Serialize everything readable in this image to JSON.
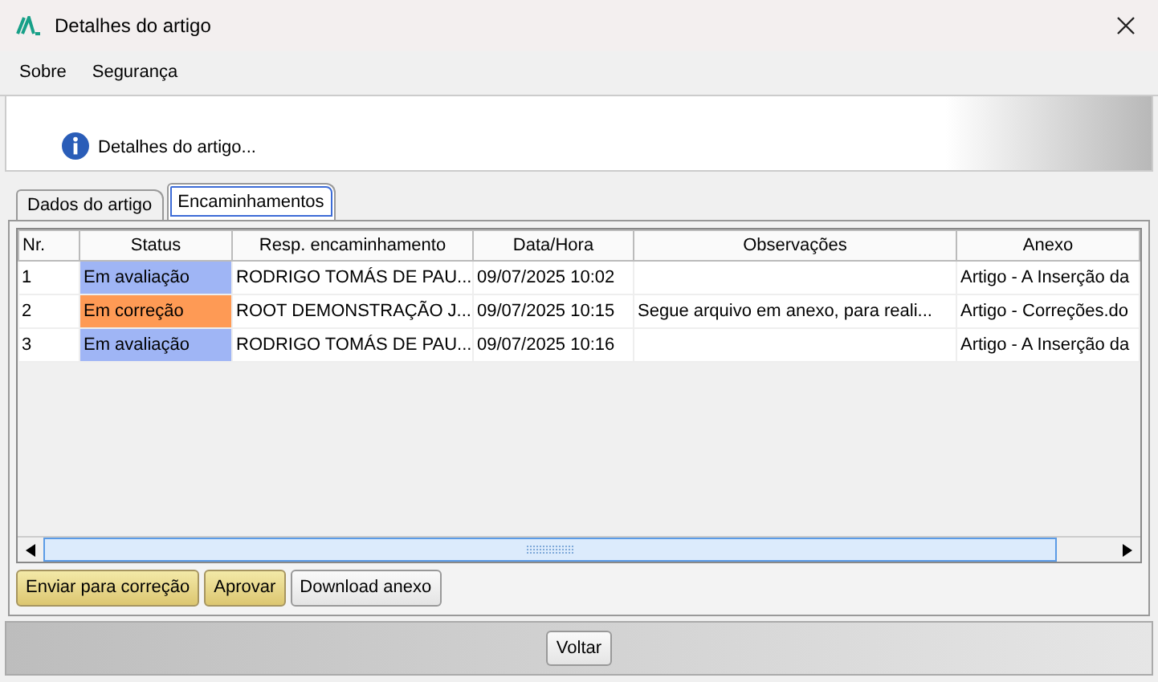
{
  "window": {
    "title": "Detalhes do artigo"
  },
  "menu": [
    "Sobre",
    "Segurança"
  ],
  "header": {
    "text": "Detalhes do artigo..."
  },
  "tabs": [
    {
      "label": "Dados do artigo",
      "selected": false
    },
    {
      "label": "Encaminhamentos",
      "selected": true
    }
  ],
  "table": {
    "columns": [
      "Nr.",
      "Status",
      "Resp. encaminhamento",
      "Data/Hora",
      "Observações",
      "Anexo"
    ],
    "rows": [
      {
        "nr": "1",
        "status": "Em avaliação",
        "color": "#9fb5f5",
        "resp": "RODRIGO TOMÁS DE PAU...",
        "datetime": "09/07/2025 10:02",
        "obs": "",
        "anexo": "Artigo - A Inserção da"
      },
      {
        "nr": "2",
        "status": "Em correção",
        "color": "#fe9a55",
        "resp": "ROOT DEMONSTRAÇÃO J...",
        "datetime": "09/07/2025 10:15",
        "obs": "Segue arquivo em anexo, para reali...",
        "anexo": "Artigo - Correções.do"
      },
      {
        "nr": "3",
        "status": "Em avaliação",
        "color": "#9fb5f5",
        "resp": "RODRIGO TOMÁS DE PAU...",
        "datetime": "09/07/2025 10:16",
        "obs": "",
        "anexo": "Artigo - A Inserção da"
      }
    ]
  },
  "actions": [
    {
      "label": "Enviar para correção",
      "kind": "highlight"
    },
    {
      "label": "Aprovar",
      "kind": "highlight"
    },
    {
      "label": "Download anexo",
      "kind": "plain"
    }
  ],
  "footer": {
    "button": "Voltar"
  }
}
